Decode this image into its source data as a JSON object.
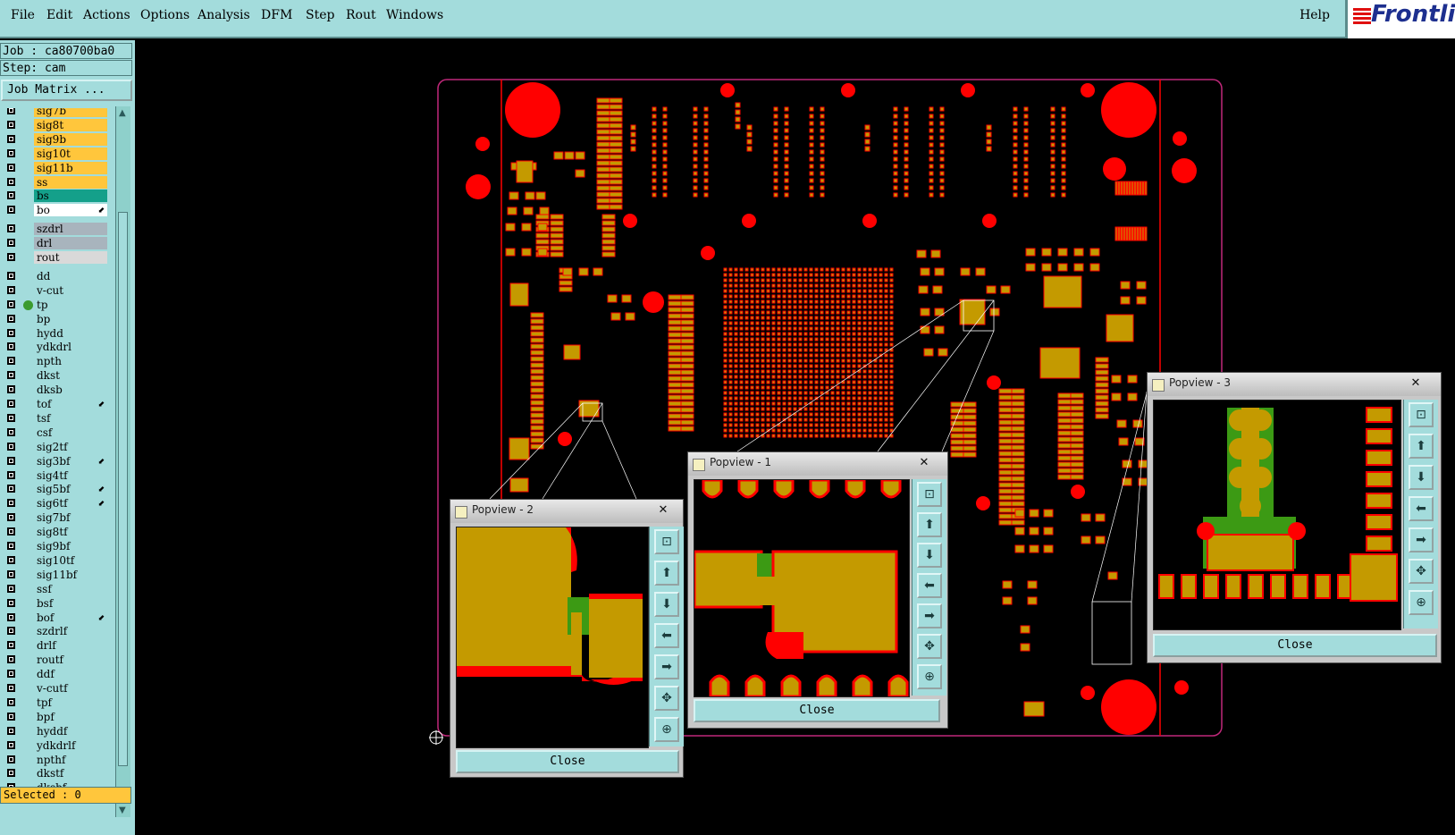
{
  "menu": {
    "file": "File",
    "edit": "Edit",
    "actions": "Actions",
    "options": "Options",
    "analysis": "Analysis",
    "dfm": "DFM",
    "step": "Step",
    "rout": "Rout",
    "windows": "Windows",
    "help": "Help"
  },
  "logo": "Frontli",
  "job": "Job : ca80700ba0",
  "step": "Step: cam",
  "job_matrix_button": "Job Matrix ...",
  "selected": "Selected : 0",
  "layers": [
    {
      "name": "sig7b",
      "color": "#ffc63c"
    },
    {
      "name": "sig8t",
      "color": "#ffc63c"
    },
    {
      "name": "sig9b",
      "color": "#ffc63c"
    },
    {
      "name": "sig10t",
      "color": "#ffc63c"
    },
    {
      "name": "sig11b",
      "color": "#ffc63c"
    },
    {
      "name": "ss",
      "color": "#ffc63c"
    },
    {
      "name": "bs",
      "color": "#14a08a"
    },
    {
      "name": "bo",
      "color": "#ffffff",
      "mark": true
    },
    {
      "name": "szdrl",
      "color": "#a8b4bd",
      "gap": true
    },
    {
      "name": "drl",
      "color": "#a8b4bd"
    },
    {
      "name": "rout",
      "color": "#d9d9d9"
    },
    {
      "name": "dd",
      "color": "#a3dcdc",
      "gap": true
    },
    {
      "name": "v-cut",
      "color": "#a3dcdc"
    },
    {
      "name": "tp",
      "color": "#a3dcdc",
      "active": true
    },
    {
      "name": "bp",
      "color": "#a3dcdc"
    },
    {
      "name": "hydd",
      "color": "#a3dcdc"
    },
    {
      "name": "ydkdrl",
      "color": "#a3dcdc"
    },
    {
      "name": "npth",
      "color": "#a3dcdc"
    },
    {
      "name": "dkst",
      "color": "#a3dcdc"
    },
    {
      "name": "dksb",
      "color": "#a3dcdc"
    },
    {
      "name": "tof",
      "color": "#a3dcdc",
      "mark": true
    },
    {
      "name": "tsf",
      "color": "#a3dcdc"
    },
    {
      "name": "csf",
      "color": "#a3dcdc"
    },
    {
      "name": "sig2tf",
      "color": "#a3dcdc"
    },
    {
      "name": "sig3bf",
      "color": "#a3dcdc",
      "mark": true
    },
    {
      "name": "sig4tf",
      "color": "#a3dcdc"
    },
    {
      "name": "sig5bf",
      "color": "#a3dcdc",
      "mark": true
    },
    {
      "name": "sig6tf",
      "color": "#a3dcdc",
      "mark": true
    },
    {
      "name": "sig7bf",
      "color": "#a3dcdc"
    },
    {
      "name": "sig8tf",
      "color": "#a3dcdc"
    },
    {
      "name": "sig9bf",
      "color": "#a3dcdc"
    },
    {
      "name": "sig10tf",
      "color": "#a3dcdc"
    },
    {
      "name": "sig11bf",
      "color": "#a3dcdc"
    },
    {
      "name": "ssf",
      "color": "#a3dcdc"
    },
    {
      "name": "bsf",
      "color": "#a3dcdc"
    },
    {
      "name": "bof",
      "color": "#a3dcdc",
      "mark": true
    },
    {
      "name": "szdrlf",
      "color": "#a3dcdc"
    },
    {
      "name": "drlf",
      "color": "#a3dcdc"
    },
    {
      "name": "routf",
      "color": "#a3dcdc"
    },
    {
      "name": "ddf",
      "color": "#a3dcdc"
    },
    {
      "name": "v-cutf",
      "color": "#a3dcdc"
    },
    {
      "name": "tpf",
      "color": "#a3dcdc"
    },
    {
      "name": "bpf",
      "color": "#a3dcdc"
    },
    {
      "name": "hyddf",
      "color": "#a3dcdc"
    },
    {
      "name": "ydkdrlf",
      "color": "#a3dcdc"
    },
    {
      "name": "npthf",
      "color": "#a3dcdc"
    },
    {
      "name": "dkstf",
      "color": "#a3dcdc"
    },
    {
      "name": "dksbf",
      "color": "#a3dcdc"
    }
  ],
  "popups": {
    "p1": {
      "title": "Popview - 1",
      "close": "Close",
      "x_icon": "✕"
    },
    "p2": {
      "title": "Popview - 2",
      "close": "Close",
      "x_icon": "✕"
    },
    "p3": {
      "title": "Popview - 3",
      "close": "Close",
      "x_icon": "✕"
    }
  },
  "colors": {
    "pad": "#c49a00",
    "copper": "#ff0000",
    "via_green": "#3c9a14",
    "outline": "#c0287a",
    "panel": "#a3dcdc",
    "highlight": "#ffc63c"
  },
  "icons": [
    "zoom-home-icon",
    "pan-up-icon",
    "pan-down-icon",
    "pan-left-icon",
    "pan-right-icon",
    "zoom-in-icon",
    "zoom-out-icon"
  ]
}
